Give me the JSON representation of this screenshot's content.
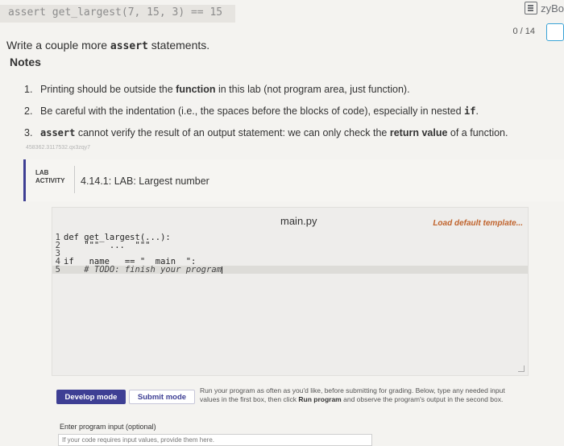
{
  "top_code": "assert get_largest(7, 15, 3) == 15",
  "brand": "zyBo",
  "intro": {
    "pre": "Write a couple more ",
    "code": "assert",
    "post": " statements."
  },
  "notes_heading": "Notes",
  "notes": [
    {
      "num": "1.",
      "pre": "Printing should be outside the ",
      "bold": "function",
      "post": " in this lab (not program area, just function)."
    },
    {
      "num": "2.",
      "pre": "Be careful with the indentation (i.e., the spaces before the blocks of code), especially in nested ",
      "code": "if",
      "post": "."
    },
    {
      "num": "3.",
      "code": "assert",
      "mid": " cannot verify the result of an output statement: we can only check the ",
      "bold": "return value",
      "post": " of a function."
    }
  ],
  "small_id": "458362.3117532.qx3zqy7",
  "lab": {
    "badge_line1": "LAB",
    "badge_line2": "ACTIVITY",
    "title": "4.14.1: LAB: Largest number",
    "score": "0 / 14"
  },
  "editor": {
    "filename": "main.py",
    "load_template": "Load default template...",
    "lines": [
      {
        "n": "1",
        "text": "def get_largest(...):"
      },
      {
        "n": "2",
        "text": "    \"\"\"  ...  \"\"\""
      },
      {
        "n": "3",
        "text": ""
      },
      {
        "n": "4",
        "text": "if __name__ == \"__main__\":"
      },
      {
        "n": "5",
        "text": "    # TODO: finish your program"
      }
    ]
  },
  "buttons": {
    "develop": "Develop mode",
    "submit": "Submit mode"
  },
  "run_note": {
    "t1": "Run your program as often as you'd like, before submitting for grading. Below, type any needed input values in the first box, then click ",
    "b1": "Run program",
    "t2": " and observe the program's output in the second box."
  },
  "input": {
    "label": "Enter program input (optional)",
    "placeholder": "If your code requires input values, provide them here."
  },
  "colors": {
    "accent": "#3e3f94",
    "template_link": "#c0632c",
    "score_box": "#3aa3d6"
  }
}
